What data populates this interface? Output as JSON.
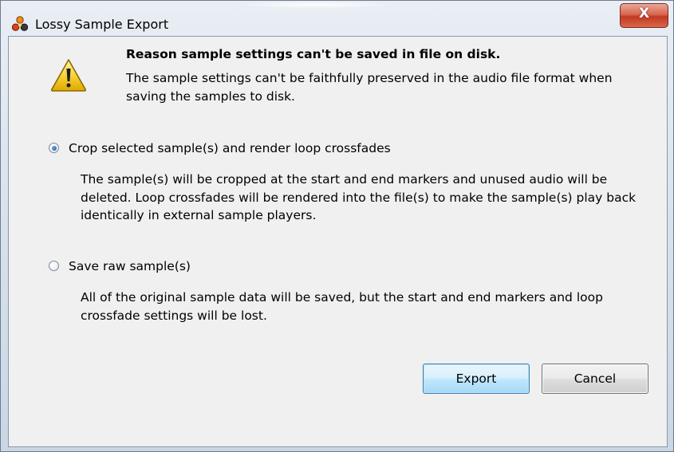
{
  "window": {
    "title": "Lossy Sample Export",
    "app_icon": "reason-app-icon",
    "close_glyph": "X"
  },
  "message": {
    "icon": "warning-icon",
    "heading": "Reason sample settings can't be saved in file on disk.",
    "description": "The sample settings can't be faithfully preserved in the audio file format when saving the samples to disk."
  },
  "options": [
    {
      "label": "Crop selected sample(s) and render loop crossfades",
      "selected": true,
      "description": "The sample(s) will be cropped at the start and end markers and unused audio will be deleted. Loop crossfades will be rendered into the file(s) to make the sample(s) play back identically in external sample players."
    },
    {
      "label": "Save raw sample(s)",
      "selected": false,
      "description": "All of the original sample data will be saved, but the start and end markers and loop crossfade settings will be lost."
    }
  ],
  "buttons": {
    "export_label": "Export",
    "cancel_label": "Cancel"
  },
  "colors": {
    "close_button": "#c23a22",
    "default_button_border": "#3c7fb1",
    "radio_selected": "#1c4f94",
    "warning_fill": "#f2c200"
  }
}
